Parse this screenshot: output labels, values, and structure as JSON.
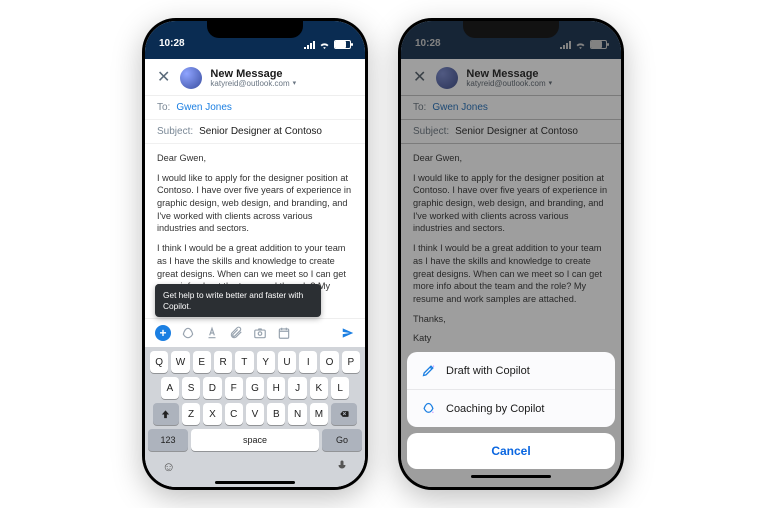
{
  "status": {
    "time": "10:28"
  },
  "header": {
    "title": "New Message",
    "email": "katyreid@outlook.com"
  },
  "fields": {
    "to_label": "To:",
    "to_value": "Gwen Jones",
    "subject_label": "Subject:",
    "subject_value": "Senior Designer at Contoso"
  },
  "body": {
    "p1": "Dear Gwen,",
    "p2": "I would like to apply for the designer position at Contoso. I have over five years of experience in graphic design, web design, and branding, and I've worked with clients across various industries and sectors.",
    "p3_a": "I think I would be a great addition to your team as I have the skills and knowledge to create great designs. When can we meet so I can get more info about the team and the role? My resume and work samples are attached.",
    "p3_b_full": "I think I would be a great addition to your team as I have the skills and knowledge to create great designs. When can we meet so I can get more info about the team and the role? My resume and work samples are attached.",
    "p4": "Thanks,",
    "p5": "Katy"
  },
  "tooltip": "Get help to write better and faster with Copilot.",
  "keyboard": {
    "row1": [
      "Q",
      "W",
      "E",
      "R",
      "T",
      "Y",
      "U",
      "I",
      "O",
      "P"
    ],
    "row2": [
      "A",
      "S",
      "D",
      "F",
      "G",
      "H",
      "J",
      "K",
      "L"
    ],
    "row3": [
      "Z",
      "X",
      "C",
      "V",
      "B",
      "N",
      "M"
    ],
    "num": "123",
    "space": "space",
    "go": "Go"
  },
  "sheet": {
    "opt1": "Draft with Copilot",
    "opt2": "Coaching by Copilot",
    "cancel": "Cancel"
  }
}
